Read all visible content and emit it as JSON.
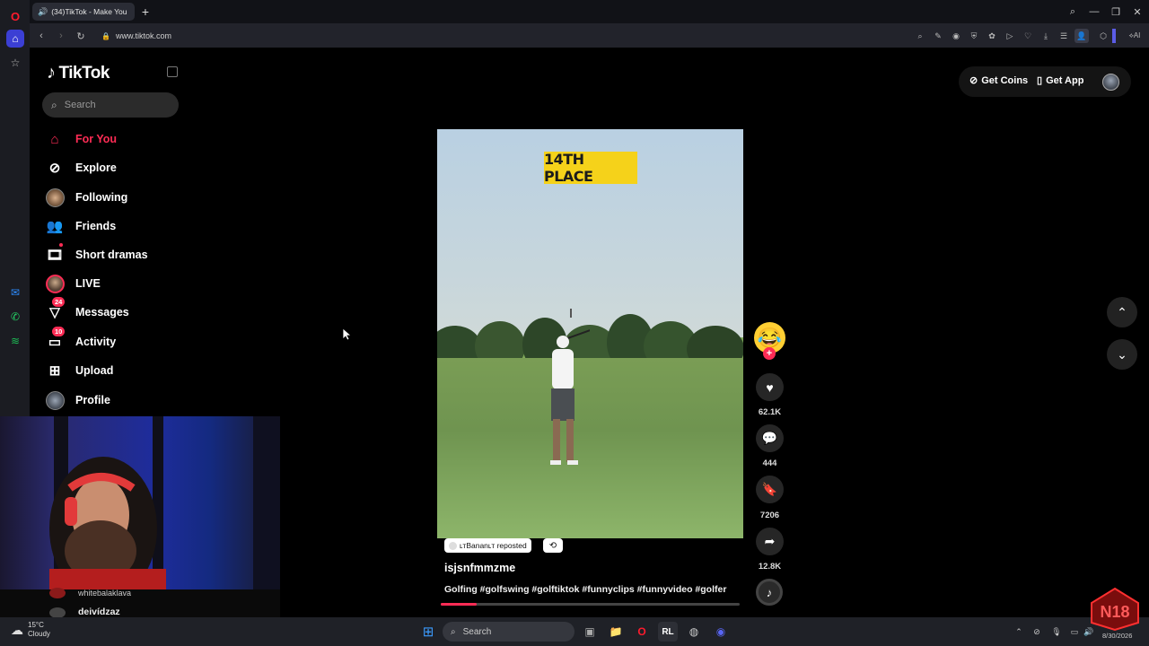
{
  "browser": {
    "tab_title": "(34)TikTok - Make You",
    "url": "www.tiktok.com"
  },
  "tiktok": {
    "logo_text": "TikTok",
    "search_placeholder": "Search",
    "nav": [
      {
        "label": "For You",
        "icon": "home-icon",
        "active": true
      },
      {
        "label": "Explore",
        "icon": "compass-icon"
      },
      {
        "label": "Following",
        "icon": "following-avatar"
      },
      {
        "label": "Friends",
        "icon": "friends-icon"
      },
      {
        "label": "Short dramas",
        "icon": "film-icon"
      },
      {
        "label": "LIVE",
        "icon": "live-avatar"
      },
      {
        "label": "Messages",
        "icon": "messages-icon",
        "badge": "24"
      },
      {
        "label": "Activity",
        "icon": "activity-icon",
        "badge": "10"
      },
      {
        "label": "Upload",
        "icon": "upload-icon"
      },
      {
        "label": "Profile",
        "icon": "profile-avatar"
      }
    ],
    "get_coins": "Get Coins",
    "get_app": "Get App",
    "video": {
      "overlay_text": "14TH PLACE",
      "reposted_by": "ʟᴛBananʟᴛ reposted",
      "author": "isjsnfmmzme",
      "description": "Golfing #golfswing #golftiktok #funnyclips #funnyvideo #golfer",
      "progress": 0.12
    },
    "actions": {
      "likes": "62.1K",
      "comments": "444",
      "saves": "7206",
      "shares": "12.8K"
    }
  },
  "stream_chat": [
    {
      "user": "whitebalaklava"
    },
    {
      "user": "deivídzaz"
    }
  ],
  "taskbar": {
    "weather_temp": "15°C",
    "weather_desc": "Cloudy",
    "search_label": "Search",
    "clock_date": "8/30/2026"
  },
  "colors": {
    "tiktok_accent": "#fe2c55",
    "label_yellow": "#f5d21a"
  }
}
